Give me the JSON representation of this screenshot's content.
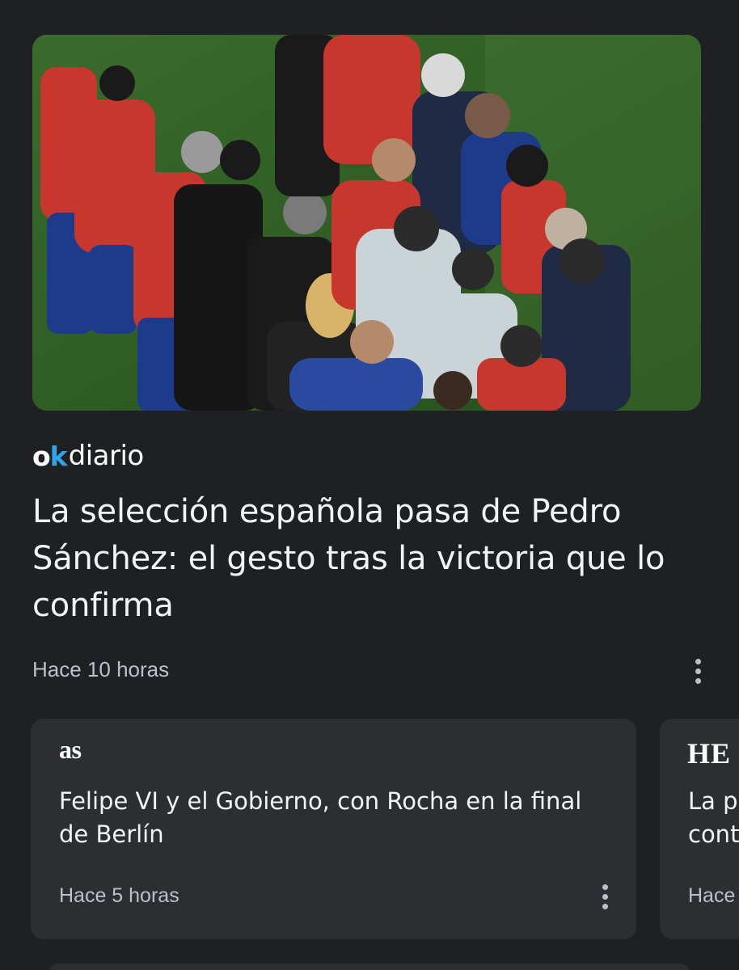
{
  "main_article": {
    "source": {
      "name_part1": "o",
      "name_part1_accent": "k",
      "name_part2": "diario"
    },
    "headline": "La selección española pasa de Pedro Sánchez: el gesto tras la victoria que lo confirma",
    "timestamp": "Hace 10 horas"
  },
  "cards": [
    {
      "source": "as",
      "title": "Felipe VI y el Gobierno, con Rocha en la final de Berlín",
      "timestamp": "Hace 5 horas"
    },
    {
      "source": "HE",
      "title": "La p cont",
      "title_line1": "La p",
      "title_line2": "cont",
      "timestamp": "Hace"
    }
  ],
  "colors": {
    "background": "#1f2023",
    "card": "#2d2e31",
    "text_primary": "#f1f3f4",
    "text_secondary": "#bdc1c6",
    "okdiario_accent": "#2fa4e7"
  },
  "icons": {
    "more": "more-vert-icon"
  }
}
